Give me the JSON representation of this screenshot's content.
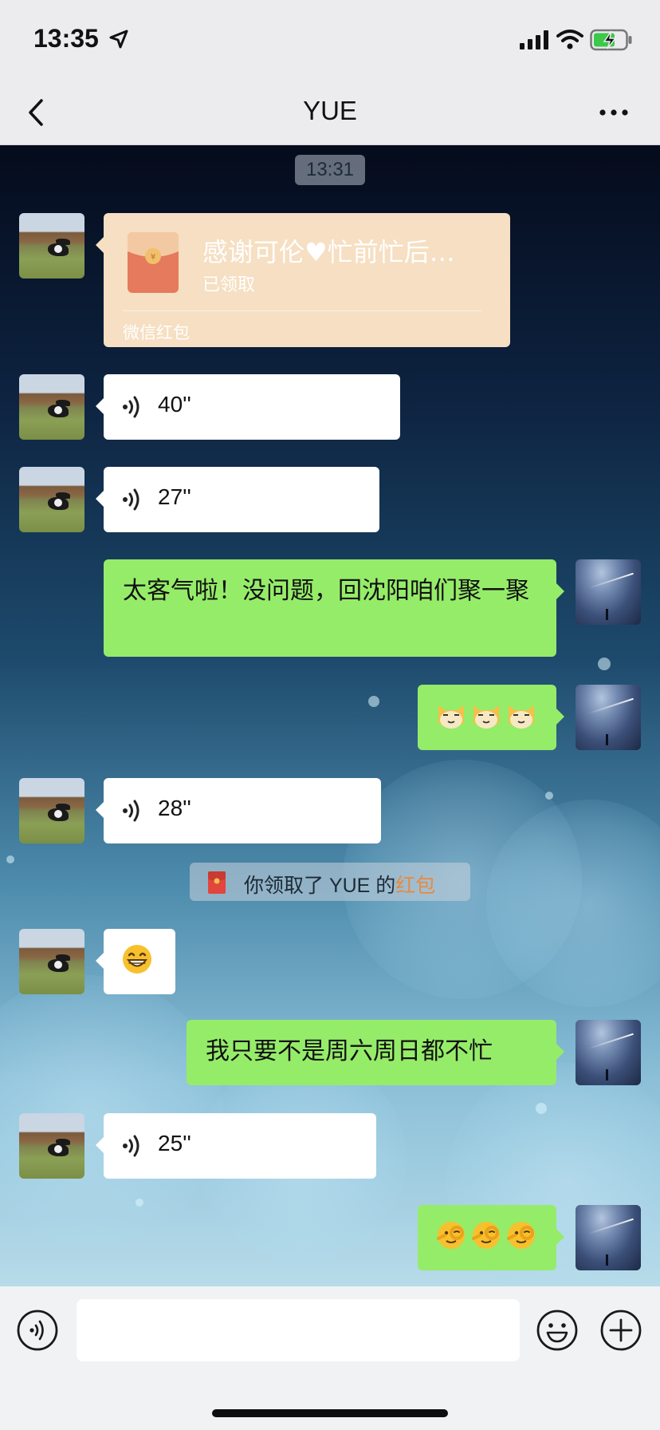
{
  "status_bar": {
    "time": "13:35",
    "icons": [
      "location-arrow-icon",
      "signal-icon",
      "wifi-icon",
      "battery-charging-icon"
    ]
  },
  "nav": {
    "title": "YUE",
    "back_icon": "chevron-left-icon",
    "more_icon": "more-dots-icon"
  },
  "chat": {
    "timestamp": "13:31",
    "red_packet": {
      "title": "感谢可伦♥忙前忙后…",
      "status": "已领取",
      "footer": "微信红包"
    },
    "voice_messages": [
      "40''",
      "27''",
      "28''",
      "25''"
    ],
    "sent_text_1": "太客气啦！没问题，回沈阳咱们聚一聚",
    "sent_text_2": "我只要不是周六周日都不忙",
    "emoji_groups": {
      "sent_1": [
        "cat-face-emoji",
        "cat-face-emoji",
        "cat-face-emoji"
      ],
      "received": [
        "grin-emoji"
      ],
      "sent_2": [
        "ok-hand-face-emoji",
        "ok-hand-face-emoji",
        "ok-hand-face-emoji"
      ]
    },
    "notice": {
      "prefix": "你领取了 YUE 的",
      "link": "红包"
    }
  },
  "input_bar": {
    "icons": [
      "voice-mode-icon",
      "emoji-icon",
      "plus-icon"
    ],
    "placeholder": ""
  },
  "colors": {
    "sent_bubble": "#95ec69",
    "received_bubble": "#ffffff",
    "red_packet_bg": "#f6dfc2",
    "notice_link": "#e88a3e"
  }
}
